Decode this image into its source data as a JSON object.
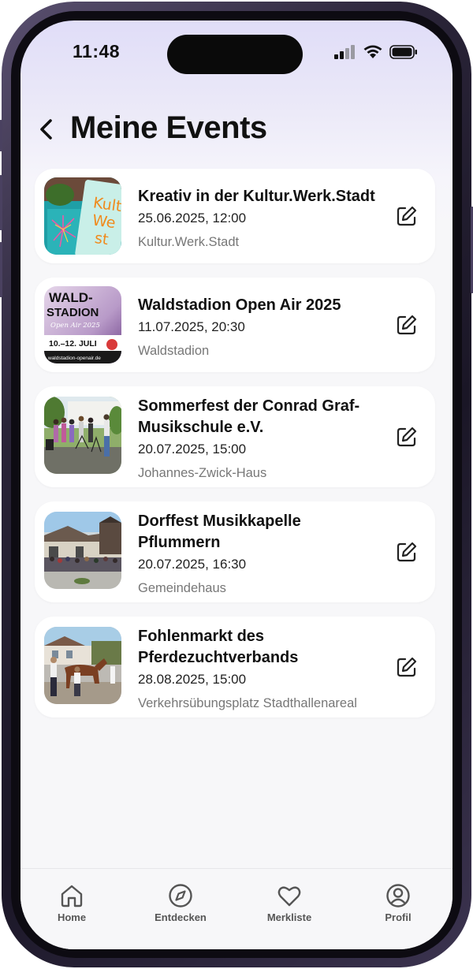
{
  "status_bar": {
    "time": "11:48"
  },
  "header": {
    "title": "Meine Events"
  },
  "events": [
    {
      "title": "Kreativ in der Kultur.Werk.Stadt",
      "datetime": "25.06.2025, 12:00",
      "venue": "Kultur.Werk.Stadt",
      "thumb_text": [
        "Kult",
        "We",
        "st"
      ]
    },
    {
      "title": "Waldstadion Open Air 2025",
      "datetime": "11.07.2025, 20:30",
      "venue": "Waldstadion",
      "thumb_text": [
        "WALD-",
        "STADION",
        "Open Air 2025",
        "10.–12. JULI",
        "waldstadion-openair.de"
      ]
    },
    {
      "title": "Sommerfest der Conrad Graf-Musikschule e.V.",
      "title_lines": [
        "Sommerfest der Conrad Graf-",
        "Musikschule e.V."
      ],
      "datetime": "20.07.2025, 15:00",
      "venue": "Johannes-Zwick-Haus"
    },
    {
      "title": "Dorffest Musikkapelle Pflummern",
      "title_lines": [
        "Dorffest Musikkapelle",
        "Pflummern"
      ],
      "datetime": "20.07.2025, 16:30",
      "venue": "Gemeindehaus"
    },
    {
      "title": "Fohlenmarkt des Pferdezuchtverbands",
      "title_lines": [
        "Fohlenmarkt des",
        "Pferdezuchtverbands"
      ],
      "datetime": "28.08.2025, 15:00",
      "venue": "Verkehrsübungsplatz Stadthallenareal"
    }
  ],
  "tab_bar": {
    "tabs": [
      {
        "label": "Home",
        "icon": "home-icon"
      },
      {
        "label": "Entdecken",
        "icon": "compass-icon"
      },
      {
        "label": "Merkliste",
        "icon": "heart-icon"
      },
      {
        "label": "Profil",
        "icon": "profile-icon"
      }
    ]
  }
}
